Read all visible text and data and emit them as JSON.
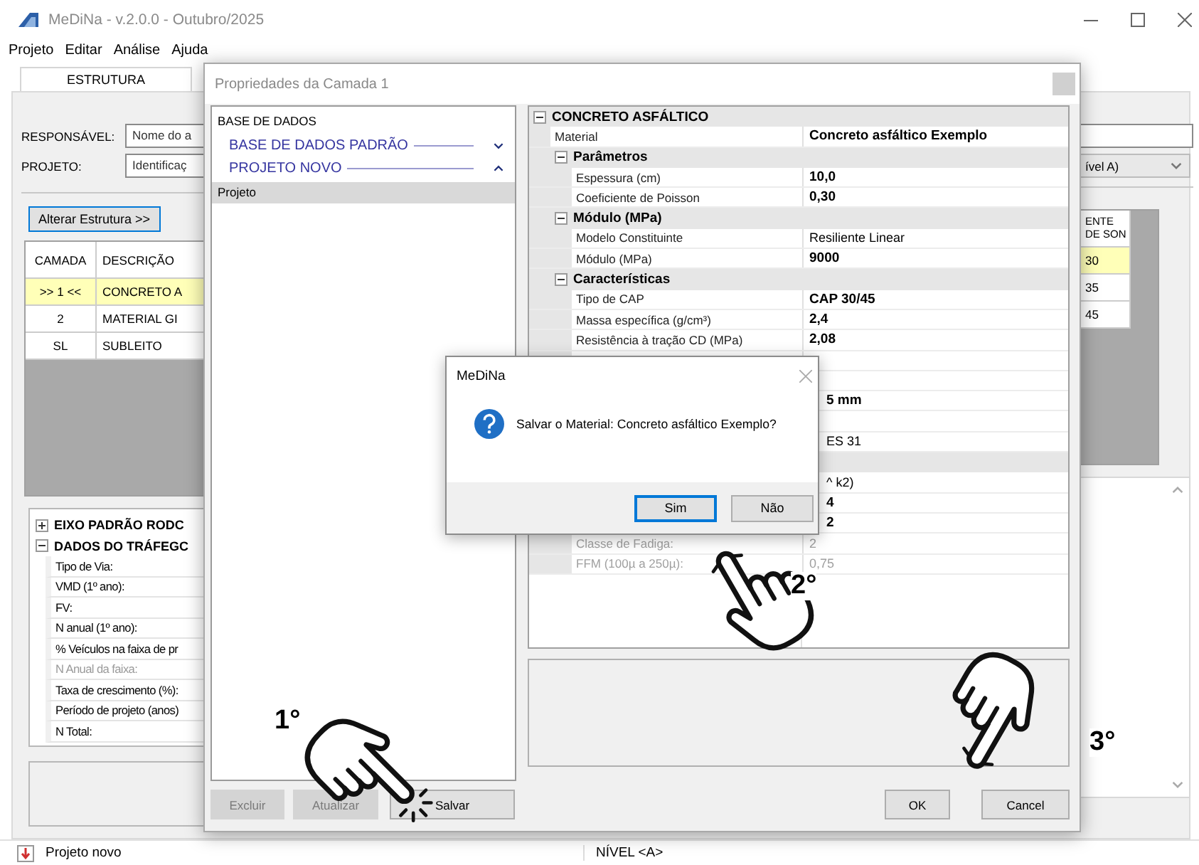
{
  "window": {
    "title": "MeDiNa - v.2.0.0 - Outubro/2025"
  },
  "menu": [
    {
      "label": "Projeto"
    },
    {
      "label": "Editar"
    },
    {
      "label": "Análise"
    },
    {
      "label": "Ajuda"
    }
  ],
  "tabs": [
    {
      "label": "ESTRUTURA",
      "selected": true
    }
  ],
  "fields": [
    {
      "label": "RESPONSÁVEL:",
      "value": "Nome do a"
    },
    {
      "label": "PROJETO:",
      "value": "Identificaç"
    }
  ],
  "right_fields": [
    {
      "kind": "text"
    },
    {
      "kind": "dropdown",
      "value": "ível A)"
    }
  ],
  "alter_button": {
    "label": "Alterar Estrutura >>"
  },
  "layers_table": {
    "columns": [
      "CAMADA",
      "DESCRIÇÃO"
    ],
    "rows": [
      {
        "cells": [
          ">> 1 <<",
          "CONCRETO A"
        ],
        "selected": true
      },
      {
        "cells": [
          "2",
          "MATERIAL GI"
        ],
        "selected": false
      },
      {
        "cells": [
          "SL",
          "SUBLEITO"
        ],
        "selected": false
      }
    ]
  },
  "layers_table_right": {
    "column": "ENTE DE SON",
    "rows": [
      {
        "cell": "30",
        "selected": true
      },
      {
        "cell": "35",
        "selected": false
      },
      {
        "cell": "45",
        "selected": false
      }
    ]
  },
  "traffic_tree": [
    {
      "label": "EIXO PADRÃO RODC",
      "expanded": false
    },
    {
      "label": "DADOS DO TRÁFEGC",
      "expanded": true,
      "children": [
        {
          "label": "Tipo de Via:",
          "disabled": false
        },
        {
          "label": "VMD (1º ano):",
          "disabled": false
        },
        {
          "label": "FV:",
          "disabled": false
        },
        {
          "label": "N anual (1º ano):",
          "disabled": false
        },
        {
          "label": "% Veículos na faixa de pr",
          "disabled": false
        },
        {
          "label": "N Anual da faixa:",
          "disabled": true
        },
        {
          "label": "Taxa de crescimento (%):",
          "disabled": false
        },
        {
          "label": "Período de projeto (anos)",
          "disabled": false
        },
        {
          "label": "N Total:",
          "disabled": false
        }
      ]
    }
  ],
  "dialog": {
    "title": "Propriedades da Camada 1",
    "database": {
      "heading": "BASE DE DADOS",
      "groups": [
        {
          "label": "BASE DE DADOS PADRÃO",
          "expanded": false
        },
        {
          "label": "PROJETO NOVO",
          "expanded": true
        }
      ],
      "items": [
        {
          "label": "Projeto",
          "selected": true
        }
      ]
    },
    "properties": [
      {
        "kind": "category",
        "label": "CONCRETO ASFÁLTICO",
        "expanded": true,
        "children": [
          {
            "kind": "property",
            "label": "Material",
            "value": "Concreto asfáltico Exemplo",
            "bold": true,
            "disabled": false
          },
          {
            "kind": "category",
            "label": "Parâmetros",
            "expanded": true,
            "children": [
              {
                "kind": "property",
                "label": "Espessura (cm)",
                "value": "10,0",
                "bold": true,
                "disabled": false
              },
              {
                "kind": "property",
                "label": "Coeficiente de Poisson",
                "value": "0,30",
                "bold": true,
                "disabled": false
              }
            ]
          },
          {
            "kind": "category",
            "label": "Módulo (MPa)",
            "expanded": true,
            "children": [
              {
                "kind": "property",
                "label": "Modelo Constituinte",
                "value": "Resiliente Linear",
                "bold": false,
                "disabled": false
              },
              {
                "kind": "property",
                "label": "Módulo (MPa)",
                "value": "9000",
                "bold": true,
                "disabled": false
              }
            ]
          },
          {
            "kind": "category",
            "label": "Características",
            "expanded": true,
            "children": [
              {
                "kind": "property",
                "label": "Tipo de CAP",
                "value": "CAP 30/45",
                "bold": true,
                "disabled": false
              },
              {
                "kind": "property",
                "label": "Massa específica (g/cm³)",
                "value": "2,4",
                "bold": true,
                "disabled": false
              },
              {
                "kind": "property",
                "label": "Resistência à tração CD (MPa)",
                "value": "2,08",
                "bold": true,
                "disabled": false
              },
              {
                "kind": "property"
              },
              {
                "kind": "property"
              },
              {
                "kind": "property",
                "cut": true,
                "value": "5 mm",
                "bold": true,
                "disabled": false
              },
              {
                "kind": "property"
              },
              {
                "kind": "property",
                "cut": true,
                "value": "ES 31",
                "bold": false,
                "disabled": false
              }
            ]
          },
          {
            "kind": "category",
            "children": [
              {
                "kind": "property",
                "cut": true,
                "value": "^ k2)",
                "bold": false,
                "disabled": false
              },
              {
                "kind": "property",
                "cut": true,
                "value": "4",
                "bold": true,
                "disabled": false
              },
              {
                "kind": "property",
                "cut": true,
                "value": "2",
                "bold": true,
                "disabled": false
              },
              {
                "kind": "property",
                "label": "Classe de Fadiga:",
                "value": "2",
                "bold": false,
                "disabled": true
              },
              {
                "kind": "property",
                "label": "FFM (100µ a 250µ):",
                "value": "0,75",
                "bold": false,
                "disabled": true
              }
            ]
          }
        ]
      }
    ],
    "buttons": [
      {
        "label": "Excluir",
        "disabled": true
      },
      {
        "label": "Atualizar",
        "disabled": true
      },
      {
        "label": "Salvar",
        "disabled": false
      }
    ],
    "confirm_buttons": [
      {
        "label": "OK"
      },
      {
        "label": "Cancel"
      }
    ]
  },
  "message_box": {
    "title": "MeDiNa",
    "text": "Salvar o Material: Concreto asfáltico Exemplo?",
    "buttons": [
      {
        "label": "Sim",
        "focused": true
      },
      {
        "label": "Não",
        "focused": false
      }
    ]
  },
  "annotations": [
    {
      "label": "1°"
    },
    {
      "label": "2°"
    },
    {
      "label": "3°"
    }
  ],
  "status_bar": {
    "items": [
      {
        "text": "Projeto novo"
      },
      {
        "text": "NÍVEL <A>"
      }
    ]
  }
}
